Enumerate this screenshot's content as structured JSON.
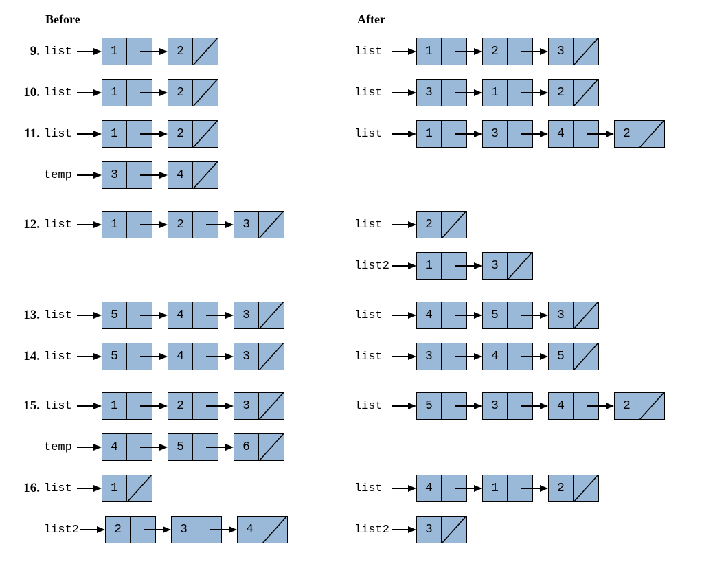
{
  "headers": {
    "before": "Before",
    "after": "After"
  },
  "arrow_color": "#000000",
  "node_fill": "#9ab9d8",
  "node_stroke": "#000000",
  "problems": [
    {
      "num": "9.",
      "before": [
        {
          "label": "list",
          "nodes": [
            1,
            2
          ]
        }
      ],
      "after": [
        {
          "label": "list",
          "nodes": [
            1,
            2,
            3
          ]
        }
      ]
    },
    {
      "num": "10.",
      "before": [
        {
          "label": "list",
          "nodes": [
            1,
            2
          ]
        }
      ],
      "after": [
        {
          "label": "list",
          "nodes": [
            3,
            1,
            2
          ]
        }
      ]
    },
    {
      "num": "11.",
      "before": [
        {
          "label": "list",
          "nodes": [
            1,
            2
          ]
        },
        {
          "label": "temp",
          "nodes": [
            3,
            4
          ]
        }
      ],
      "after": [
        {
          "label": "list",
          "nodes": [
            1,
            3,
            4,
            2
          ]
        },
        {
          "label": "",
          "nodes": []
        }
      ]
    },
    {
      "num": "12.",
      "before": [
        {
          "label": "list",
          "nodes": [
            1,
            2,
            3
          ]
        },
        {
          "label": "",
          "nodes": []
        }
      ],
      "after": [
        {
          "label": "list",
          "nodes": [
            2
          ]
        },
        {
          "label": "list2",
          "nodes": [
            1,
            3
          ]
        }
      ],
      "short_spacer_before": true
    },
    {
      "num": "13.",
      "before": [
        {
          "label": "list",
          "nodes": [
            5,
            4,
            3
          ]
        }
      ],
      "after": [
        {
          "label": "list",
          "nodes": [
            4,
            5,
            3
          ]
        }
      ],
      "short_spacer_before": true
    },
    {
      "num": "14.",
      "before": [
        {
          "label": "list",
          "nodes": [
            5,
            4,
            3
          ]
        }
      ],
      "after": [
        {
          "label": "list",
          "nodes": [
            3,
            4,
            5
          ]
        }
      ]
    },
    {
      "num": "15.",
      "before": [
        {
          "label": "list",
          "nodes": [
            1,
            2,
            3
          ]
        },
        {
          "label": "temp",
          "nodes": [
            4,
            5,
            6
          ]
        }
      ],
      "after": [
        {
          "label": "list",
          "nodes": [
            5,
            3,
            4,
            2
          ]
        },
        {
          "label": "",
          "nodes": []
        }
      ],
      "short_spacer_before": true
    },
    {
      "num": "16.",
      "before": [
        {
          "label": "list",
          "nodes": [
            1
          ]
        },
        {
          "label": "list2",
          "nodes": [
            2,
            3,
            4
          ]
        }
      ],
      "after": [
        {
          "label": "list",
          "nodes": [
            4,
            1,
            2
          ]
        },
        {
          "label": "list2",
          "nodes": [
            3
          ]
        }
      ]
    }
  ]
}
